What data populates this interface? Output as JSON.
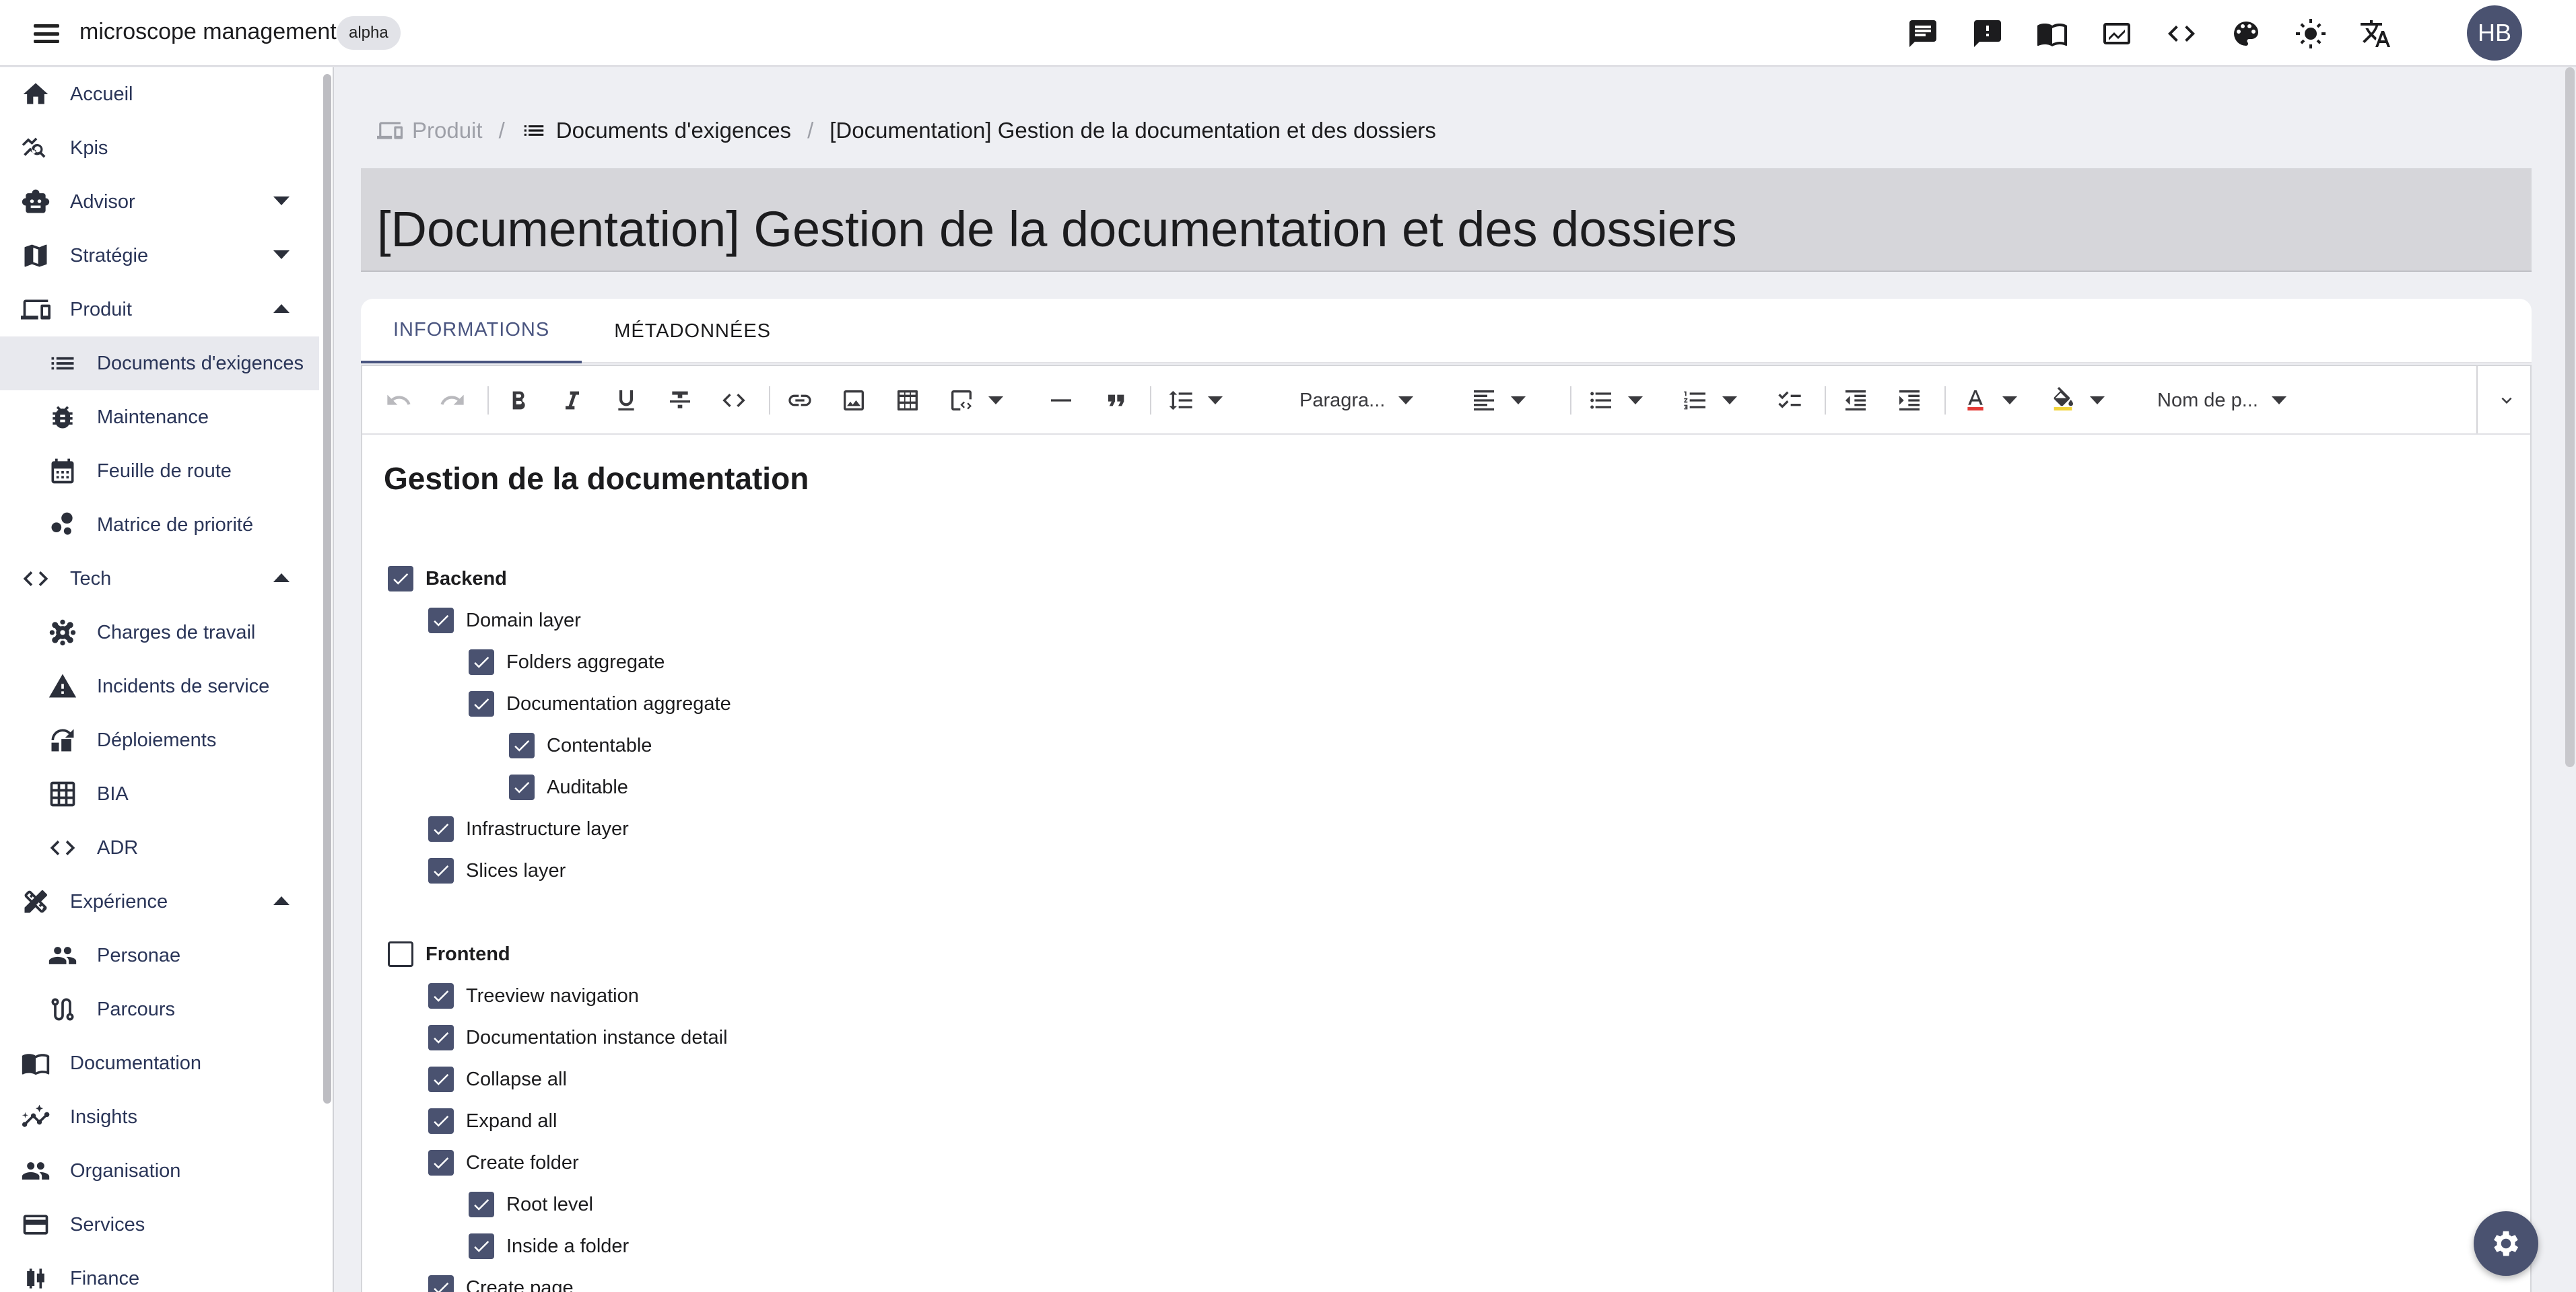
{
  "app": {
    "title": "microscope management",
    "badge": "alpha",
    "user_initials": "HB"
  },
  "topbar_icons": [
    "chat-icon",
    "feedback-icon",
    "book-icon",
    "analytics-icon",
    "code-icon",
    "palette-icon",
    "brightness-icon",
    "translate-icon"
  ],
  "sidebar": {
    "items": [
      {
        "label": "Accueil",
        "icon": "home-icon",
        "level": 0
      },
      {
        "label": "Kpis",
        "icon": "query-stats-icon",
        "level": 0
      },
      {
        "label": "Advisor",
        "icon": "robot-icon",
        "level": 0,
        "expand": "down"
      },
      {
        "label": "Stratégie",
        "icon": "map-icon",
        "level": 0,
        "expand": "down"
      },
      {
        "label": "Produit",
        "icon": "devices-icon",
        "level": 0,
        "expand": "up"
      },
      {
        "label": "Documents d'exigences",
        "icon": "list-icon",
        "level": 1,
        "active": true
      },
      {
        "label": "Maintenance",
        "icon": "bug-icon",
        "level": 1
      },
      {
        "label": "Feuille de route",
        "icon": "calendar-icon",
        "level": 1
      },
      {
        "label": "Matrice de priorité",
        "icon": "bubble-icon",
        "level": 1
      },
      {
        "label": "Tech",
        "icon": "code-icon",
        "level": 0,
        "expand": "up"
      },
      {
        "label": "Charges de travail",
        "icon": "hub-icon",
        "level": 1
      },
      {
        "label": "Incidents de service",
        "icon": "warning-icon",
        "level": 1
      },
      {
        "label": "Déploiements",
        "icon": "deploy-icon",
        "level": 1
      },
      {
        "label": "BIA",
        "icon": "grid-icon",
        "level": 1
      },
      {
        "label": "ADR",
        "icon": "code-icon",
        "level": 1
      },
      {
        "label": "Expérience",
        "icon": "design-icon",
        "level": 0,
        "expand": "up"
      },
      {
        "label": "Personae",
        "icon": "people-icon",
        "level": 1
      },
      {
        "label": "Parcours",
        "icon": "route-icon",
        "level": 1
      },
      {
        "label": "Documentation",
        "icon": "book-icon",
        "level": 0
      },
      {
        "label": "Insights",
        "icon": "insights-icon",
        "level": 0
      },
      {
        "label": "Organisation",
        "icon": "people-icon",
        "level": 0
      },
      {
        "label": "Services",
        "icon": "card-icon",
        "level": 0
      },
      {
        "label": "Finance",
        "icon": "candlestick-icon",
        "level": 0
      }
    ]
  },
  "breadcrumb": {
    "root": "Produit",
    "section": "Documents d'exigences",
    "current": "[Documentation] Gestion de la documentation et des dossiers"
  },
  "page": {
    "title": "[Documentation] Gestion de la documentation et des dossiers"
  },
  "tabs": [
    {
      "label": "INFORMATIONS",
      "active": true
    },
    {
      "label": "MÉTADONNÉES",
      "active": false
    }
  ],
  "toolbar": {
    "block_type": "Paragra...",
    "font_name": "Nom de p..."
  },
  "document": {
    "heading": "Gestion de la documentation",
    "items": [
      {
        "label": "Backend",
        "checked": true,
        "depth": 0,
        "bold": true
      },
      {
        "label": "Domain layer",
        "checked": true,
        "depth": 1
      },
      {
        "label": "Folders aggregate",
        "checked": true,
        "depth": 2
      },
      {
        "label": "Documentation aggregate",
        "checked": true,
        "depth": 2
      },
      {
        "label": "Contentable",
        "checked": true,
        "depth": 3
      },
      {
        "label": "Auditable",
        "checked": true,
        "depth": 3
      },
      {
        "label": "Infrastructure layer",
        "checked": true,
        "depth": 1
      },
      {
        "label": "Slices layer",
        "checked": true,
        "depth": 1
      },
      {
        "label": "Frontend",
        "checked": false,
        "depth": 0,
        "bold": true,
        "gap": true
      },
      {
        "label": "Treeview navigation",
        "checked": true,
        "depth": 1
      },
      {
        "label": "Documentation instance detail",
        "checked": true,
        "depth": 1
      },
      {
        "label": "Collapse all",
        "checked": true,
        "depth": 1
      },
      {
        "label": "Expand all",
        "checked": true,
        "depth": 1
      },
      {
        "label": "Create folder",
        "checked": true,
        "depth": 1
      },
      {
        "label": "Root level",
        "checked": true,
        "depth": 2
      },
      {
        "label": "Inside a folder",
        "checked": true,
        "depth": 2
      },
      {
        "label": "Create page",
        "checked": true,
        "depth": 1
      }
    ]
  },
  "colors": {
    "accent": "#4a5270",
    "tab_active": "#4a5580",
    "title_bg": "#d6d6da",
    "page_bg": "#eeeff3"
  }
}
